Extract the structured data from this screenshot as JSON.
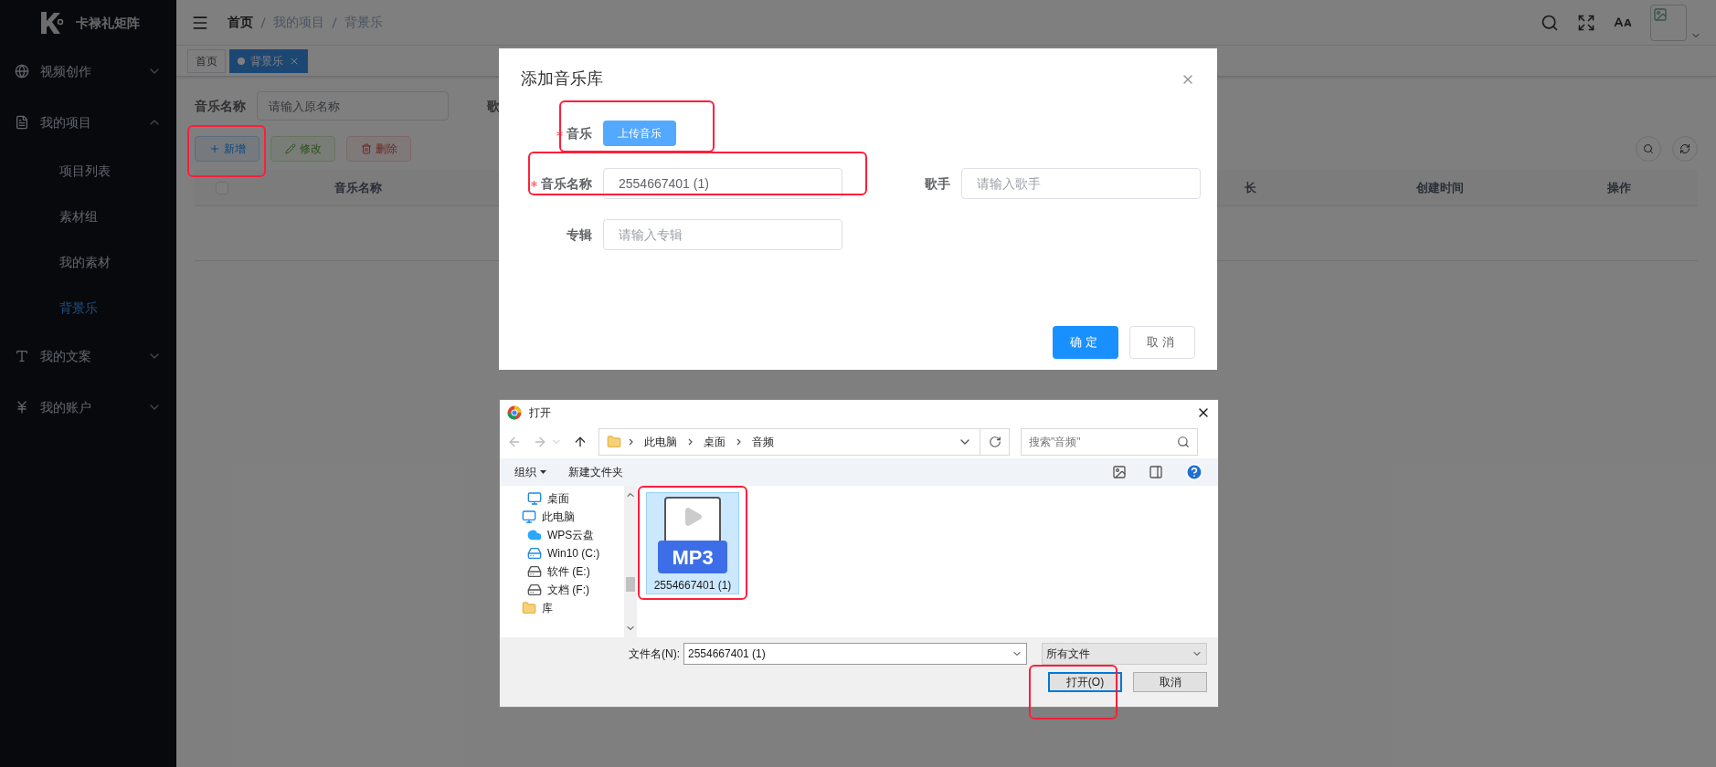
{
  "sidebar": {
    "logo_text": "卡禄礼矩阵",
    "items": [
      {
        "kind": "globe",
        "label": "视频创作",
        "expanded": false
      },
      {
        "kind": "document",
        "label": "我的项目",
        "expanded": true,
        "children": [
          {
            "label": "项目列表",
            "selected": false
          },
          {
            "label": "素材组",
            "selected": false
          },
          {
            "label": "我的素材",
            "selected": false
          },
          {
            "label": "背景乐",
            "selected": true
          }
        ]
      },
      {
        "kind": "text",
        "label": "我的文案",
        "expanded": false
      },
      {
        "kind": "yen",
        "label": "我的账户",
        "expanded": false
      }
    ]
  },
  "header": {
    "breadcrumb": [
      "首页",
      "我的项目",
      "背景乐"
    ]
  },
  "tabs": [
    {
      "label": "首页",
      "selected": false
    },
    {
      "label": "背景乐",
      "selected": true
    }
  ],
  "search": {
    "label": "音乐名称",
    "placeholder": "请输入原名称",
    "label_2": "歌"
  },
  "toolbar": [
    {
      "label": "新增",
      "kind": "add",
      "disabled": false
    },
    {
      "label": "修改",
      "kind": "edit",
      "disabled": true
    },
    {
      "label": "删除",
      "kind": "delete",
      "disabled": true
    }
  ],
  "table": {
    "select_all_checked": false,
    "columns": [
      "音乐名称",
      "长",
      "创建时间",
      "操作"
    ]
  },
  "modal": {
    "title": "添加音乐库",
    "upload_label": "音乐",
    "upload_required": true,
    "upload_button": "上传音乐",
    "fields": [
      {
        "label": "音乐名称",
        "required": true,
        "value": "2554667401 (1)"
      },
      {
        "label": "歌手",
        "required": false,
        "placeholder": "请输入歌手"
      },
      {
        "label": "专辑",
        "required": false,
        "placeholder": "请输入专辑"
      }
    ],
    "buttons": [
      {
        "label": "确定",
        "kind": "primary"
      },
      {
        "label": "取消",
        "kind": "default"
      }
    ]
  },
  "file_dialog": {
    "title": "打开",
    "path": [
      "此电脑",
      "桌面",
      "音频"
    ],
    "search_placeholder": "搜索\"音频\"",
    "organize": "组织",
    "new_folder": "新建文件夹",
    "tree": [
      {
        "label": "桌面",
        "kind": "desktop"
      },
      {
        "label": "此电脑",
        "kind": "pc",
        "children": [
          {
            "label": "WPS云盘",
            "kind": "cloud"
          },
          {
            "label": "Win10 (C:)",
            "kind": "system"
          },
          {
            "label": "软件 (E:)",
            "kind": "drive"
          },
          {
            "label": "文档 (F:)",
            "kind": "drive"
          }
        ]
      },
      {
        "label": "库",
        "kind": "library"
      }
    ],
    "files": [
      {
        "name": "2554667401 (1)",
        "badge": "MP3",
        "selected": true
      }
    ],
    "filename_label": "文件名(N):",
    "filename": "2554667401 (1)",
    "filter": "所有文件",
    "buttons": [
      {
        "label": "打开(O)",
        "kind": "default"
      },
      {
        "label": "取消",
        "kind": "normal"
      }
    ]
  }
}
